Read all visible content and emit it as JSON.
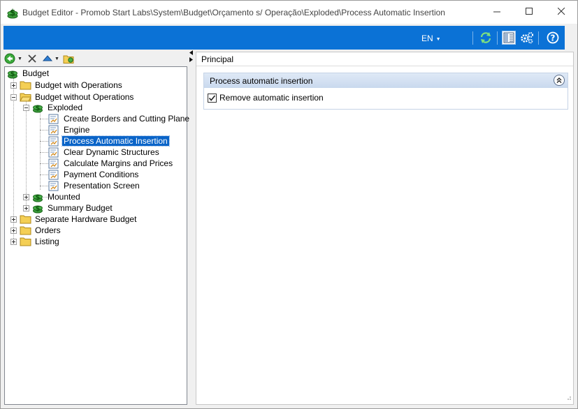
{
  "window": {
    "title": "Budget Editor - Promob Start Labs\\System\\Budget\\Orçamento s/ Operação\\Exploded\\Process Automatic Insertion",
    "controls": [
      "minimize",
      "maximize",
      "close"
    ]
  },
  "toolbar": {
    "language": "EN",
    "icons": [
      "refresh-icon",
      "panel-layout-icon",
      "settings-gears-icon",
      "help-icon"
    ]
  },
  "tree_toolbar": {
    "icons": [
      "back-icon",
      "delete-icon",
      "move-up-icon",
      "add-folder-icon"
    ]
  },
  "tree": {
    "root": "Budget",
    "items": [
      {
        "label": "Budget with Operations",
        "type": "folder",
        "expander": "plus"
      },
      {
        "label": "Budget without Operations",
        "type": "folder",
        "expander": "minus"
      },
      {
        "label": "Exploded",
        "type": "money",
        "expander": "minus"
      },
      {
        "label": "Create Borders and Cutting Plane",
        "type": "script"
      },
      {
        "label": "Engine",
        "type": "script"
      },
      {
        "label": "Process Automatic Insertion",
        "type": "script",
        "selected": true
      },
      {
        "label": "Clear Dynamic Structures",
        "type": "script"
      },
      {
        "label": "Calculate Margins and Prices",
        "type": "script"
      },
      {
        "label": "Payment Conditions",
        "type": "script"
      },
      {
        "label": "Presentation Screen",
        "type": "script"
      },
      {
        "label": "Mounted",
        "type": "money",
        "expander": "plus"
      },
      {
        "label": "Summary Budget",
        "type": "money",
        "expander": "plus"
      },
      {
        "label": "Separate Hardware Budget",
        "type": "folder",
        "expander": "plus"
      },
      {
        "label": "Orders",
        "type": "folder",
        "expander": "plus"
      },
      {
        "label": "Listing",
        "type": "folder",
        "expander": "plus"
      }
    ]
  },
  "properties": {
    "tab": "Principal",
    "group_title": "Process automatic insertion",
    "option_label": "Remove automatic insertion",
    "option_checked": true
  },
  "colors": {
    "toolbar_blue": "#0b72d6",
    "selection_blue": "#0a64c8",
    "group_header": "#d3e1f2"
  }
}
